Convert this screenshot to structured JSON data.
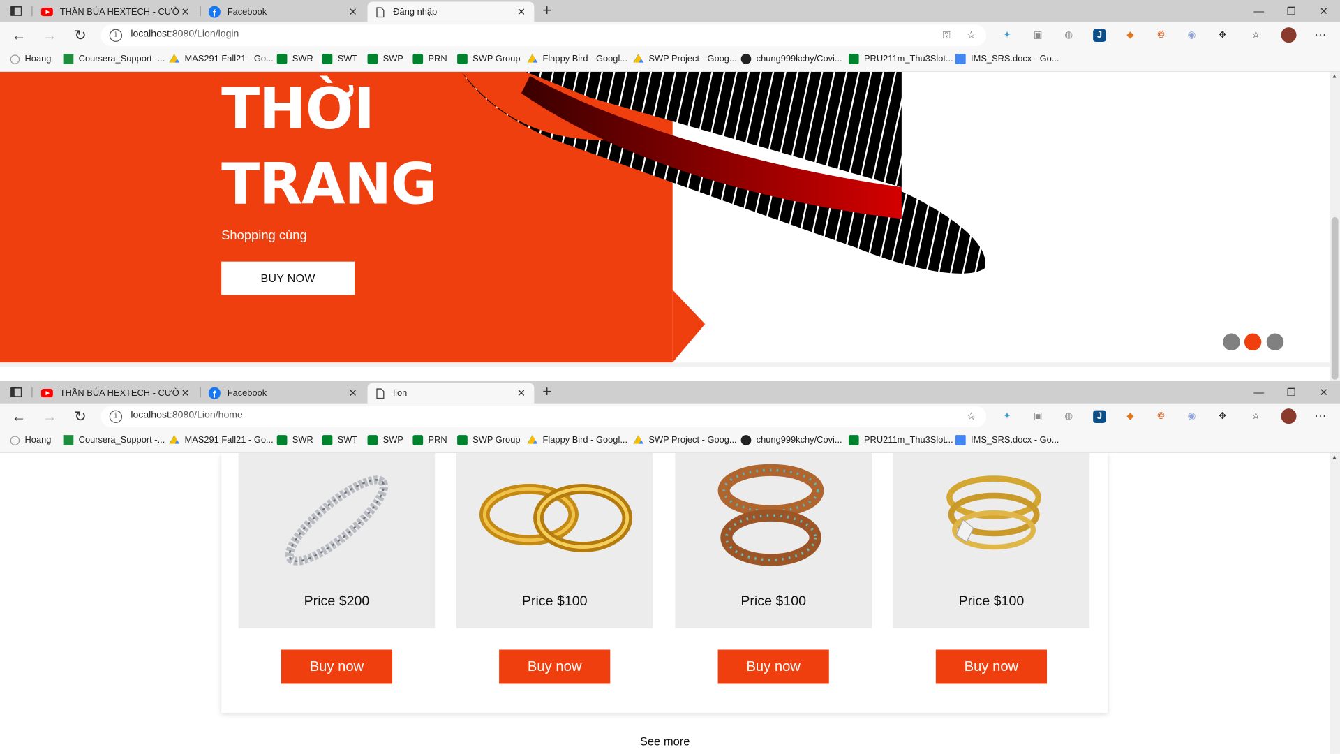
{
  "window1": {
    "tabs": [
      {
        "title": "THẦN BÚA HEXTECH - CƯỜNG ĐÔ",
        "icon": "youtube-icon"
      },
      {
        "title": "Facebook",
        "icon": "facebook-icon"
      },
      {
        "title": "Đăng nhập",
        "icon": "page-icon"
      }
    ],
    "url_host": "localhost",
    "url_path": ":8080/Lion/login",
    "hero": {
      "title_line1": "THỜI",
      "title_line2": "TRANG",
      "subtitle": "Shopping cùng",
      "button": "BUY NOW",
      "slide_count": 3,
      "active_slide": 2
    }
  },
  "window2": {
    "tabs": [
      {
        "title": "THẦN BÚA HEXTECH - CƯỜNG ĐÔ",
        "icon": "youtube-icon"
      },
      {
        "title": "Facebook",
        "icon": "facebook-icon"
      },
      {
        "title": "lion",
        "icon": "page-icon"
      }
    ],
    "url_host": "localhost",
    "url_path": ":8080/Lion/home",
    "products": [
      {
        "price": "Price $200",
        "button": "Buy now",
        "image": "silver-bracelet"
      },
      {
        "price": "Price $100",
        "button": "Buy now",
        "image": "gold-wedding-rings"
      },
      {
        "price": "Price $100",
        "button": "Buy now",
        "image": "jeweled-bangles"
      },
      {
        "price": "Price $100",
        "button": "Buy now",
        "image": "diamond-gold-ring"
      }
    ],
    "see_more": "See more"
  },
  "bookmarks": [
    {
      "label": "Hoang",
      "icon": "globe-icon",
      "color": "#999999"
    },
    {
      "label": "Coursera_Support -...",
      "icon": "sheets-icon",
      "color": "#1e8e3e"
    },
    {
      "label": "MAS291 Fall21 - Go...",
      "icon": "drive-icon",
      "color": "#fbbc04"
    },
    {
      "label": "SWR",
      "icon": "meet-icon",
      "color": "#00832d"
    },
    {
      "label": "SWT",
      "icon": "meet-icon",
      "color": "#00832d"
    },
    {
      "label": "SWP",
      "icon": "meet-icon",
      "color": "#00832d"
    },
    {
      "label": "PRN",
      "icon": "meet-icon",
      "color": "#00832d"
    },
    {
      "label": "SWP Group",
      "icon": "meet-icon",
      "color": "#00832d"
    },
    {
      "label": "Flappy Bird - Googl...",
      "icon": "drive-icon",
      "color": "#fbbc04"
    },
    {
      "label": "SWP Project - Goog...",
      "icon": "drive-icon",
      "color": "#fbbc04"
    },
    {
      "label": "chung999kchy/Covi...",
      "icon": "github-icon",
      "color": "#222222"
    },
    {
      "label": "PRU211m_Thu3Slot...",
      "icon": "meet-icon",
      "color": "#00832d"
    },
    {
      "label": "IMS_SRS.docx - Go...",
      "icon": "docs-icon",
      "color": "#4285f4"
    }
  ],
  "colors": {
    "accent": "#ef3f0f",
    "tabstrip": "#cfcfcf",
    "toolbar": "#f7f7f7"
  }
}
